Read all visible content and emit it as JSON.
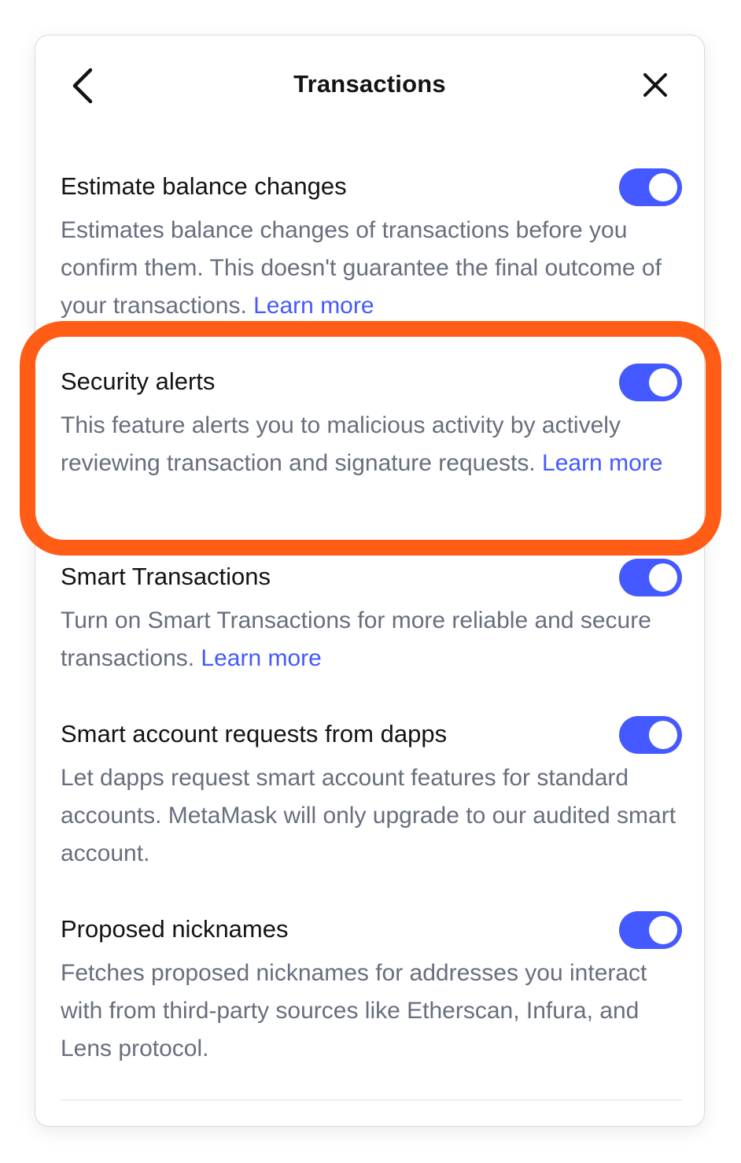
{
  "header": {
    "title": "Transactions",
    "back_icon": "chevron-left-icon",
    "close_icon": "close-icon"
  },
  "settings": [
    {
      "title": "Estimate balance changes",
      "description": "Estimates balance changes of transactions before you confirm them. This doesn't guarantee the final outcome of your transactions. ",
      "link": "Learn more",
      "enabled": true
    },
    {
      "title": "Security alerts",
      "description": "This feature alerts you to malicious activity by actively reviewing transaction and signature requests. ",
      "link": "Learn more",
      "enabled": true
    },
    {
      "title": "Smart Transactions",
      "description": "Turn on Smart Transactions for more reliable and secure transactions. ",
      "link": "Learn more",
      "enabled": true
    },
    {
      "title": "Smart account requests from dapps",
      "description": "Let dapps request smart account features for standard accounts. MetaMask will only upgrade to our audited smart account.",
      "enabled": true
    },
    {
      "title": "Proposed nicknames",
      "description": "Fetches proposed nicknames for addresses you interact with from third-party sources like Etherscan, Infura, and Lens protocol.",
      "enabled": true
    }
  ],
  "colors": {
    "accent": "#4459ff",
    "highlight": "#ff5c16",
    "text_primary": "#121314",
    "text_secondary": "#686e7d"
  }
}
